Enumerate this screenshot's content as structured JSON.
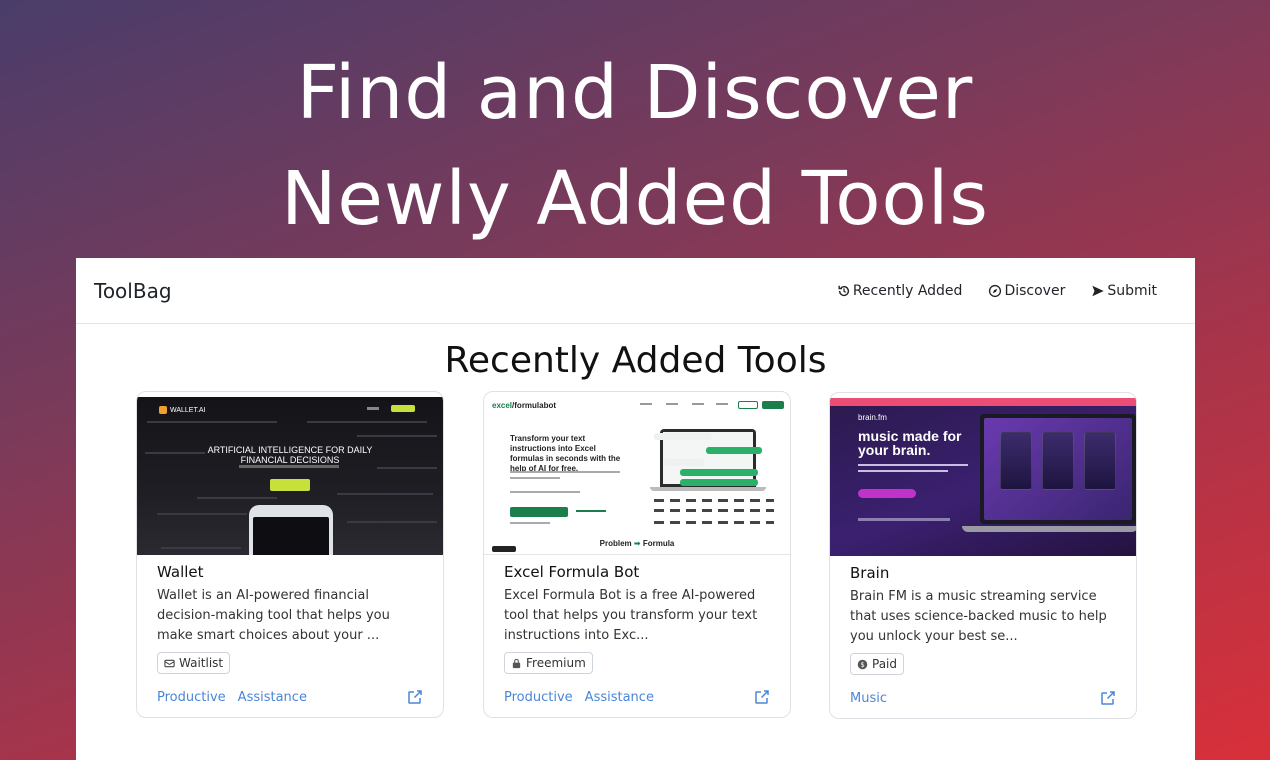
{
  "hero": {
    "line1": "Find and Discover",
    "line2": "Newly Added Tools"
  },
  "navbar": {
    "brand": "ToolBag",
    "links": [
      {
        "label": "Recently Added",
        "icon": "history-icon"
      },
      {
        "label": "Discover",
        "icon": "compass-icon"
      },
      {
        "label": "Submit",
        "icon": "send-icon"
      }
    ]
  },
  "section": {
    "title": "Recently Added Tools"
  },
  "cards": [
    {
      "title": "Wallet",
      "description": "Wallet is an AI-powered financial decision-making tool that helps you make smart choices about your ...",
      "pricing": "Waitlist",
      "pricing_icon": "waitlist-icon",
      "tags": [
        "Productive",
        "Assistance"
      ],
      "thumbnail": {
        "brand": "WALLET.AI",
        "headline_1": "ARTIFICIAL INTELLIGENCE FOR DAILY",
        "headline_2": "FINANCIAL DECISIONS"
      }
    },
    {
      "title": "Excel Formula Bot",
      "description": "Excel Formula Bot is a free AI-powered tool that helps you transform your text instructions into Exc...",
      "pricing": "Freemium",
      "pricing_icon": "lock-icon",
      "tags": [
        "Productive",
        "Assistance"
      ],
      "thumbnail": {
        "brand_1": "excel",
        "brand_2": "formulabot",
        "headline": "Transform your text instructions into Excel formulas in seconds with the help of AI for free.",
        "problem": "Problem",
        "formula": "Formula"
      }
    },
    {
      "title": "Brain",
      "description": "Brain FM is a music streaming service that uses science-backed music to help you unlock your best se...",
      "pricing": "Paid",
      "pricing_icon": "dollar-coin-icon",
      "tags": [
        "Music"
      ],
      "thumbnail": {
        "brand": "brain.fm",
        "headline": "music made for your brain."
      }
    }
  ],
  "colors": {
    "tag": "#4a86d8",
    "excel_green": "#1a7f4b",
    "wallet_accent": "#c8e03c",
    "brain_banner": "#ec4d74"
  }
}
